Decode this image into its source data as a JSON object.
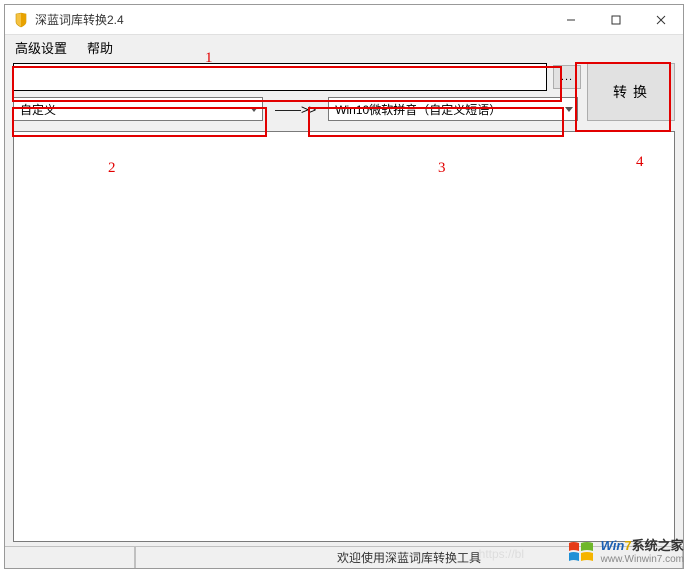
{
  "window": {
    "title": "深蓝词库转换2.4"
  },
  "menu": {
    "advanced": "高级设置",
    "help": "帮助"
  },
  "toolbar": {
    "file_value": "",
    "browse_label": "...",
    "convert_label": "转换",
    "arrow": "——>>",
    "source_combo": {
      "selected": "自定义"
    },
    "target_combo": {
      "selected": "Win10微软拼音（自定义短语）"
    }
  },
  "annotations": {
    "n1": "1",
    "n2": "2",
    "n3": "3",
    "n4": "4"
  },
  "main": {
    "text": ""
  },
  "status": {
    "message": "欢迎使用深蓝词库转换工具"
  },
  "watermark": {
    "brand_prefix": "Win",
    "brand_num": "7",
    "brand_suffix": "系统之家",
    "url": "www.Winwin7.com"
  },
  "faint": {
    "url": "https://bl"
  }
}
